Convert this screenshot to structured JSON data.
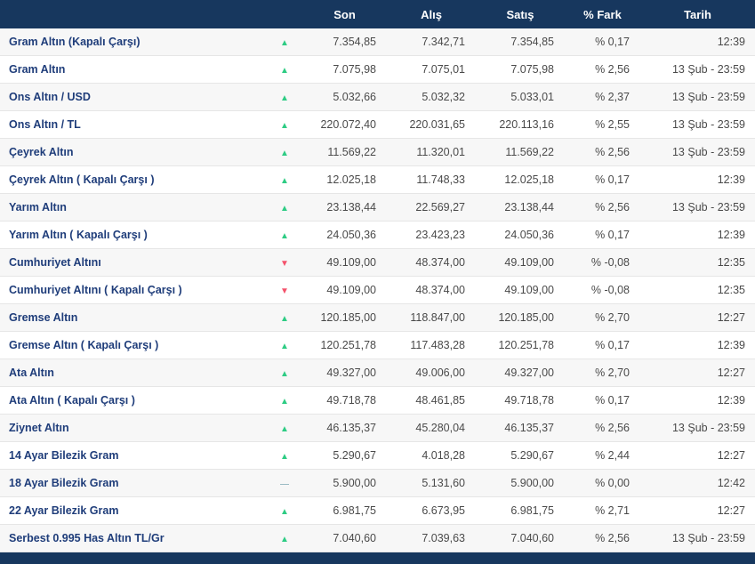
{
  "header": {
    "son": "Son",
    "alis": "Alış",
    "satis": "Satış",
    "fark": "% Fark",
    "tarih": "Tarih"
  },
  "icons": {
    "up": "▲",
    "down": "▼",
    "flat": "—"
  },
  "colors": {
    "header-bg": "#17375e",
    "name-color": "#1f3d7a",
    "value-color": "#4a4a4a",
    "up": "#2ecc84",
    "down": "#f4526b",
    "flat": "#9bbcc4",
    "row-alt": "#f7f7f7",
    "border": "#e6e6e6"
  },
  "rows": [
    {
      "name": "Gram Altın (Kapalı Çarşı)",
      "dir": "up",
      "son": "7.354,85",
      "alis": "7.342,71",
      "satis": "7.354,85",
      "fark": "% 0,17",
      "tarih": "12:39"
    },
    {
      "name": "Gram Altın",
      "dir": "up",
      "son": "7.075,98",
      "alis": "7.075,01",
      "satis": "7.075,98",
      "fark": "% 2,56",
      "tarih": "13 Şub - 23:59"
    },
    {
      "name": "Ons Altın / USD",
      "dir": "up",
      "son": "5.032,66",
      "alis": "5.032,32",
      "satis": "5.033,01",
      "fark": "% 2,37",
      "tarih": "13 Şub - 23:59"
    },
    {
      "name": "Ons Altın / TL",
      "dir": "up",
      "son": "220.072,40",
      "alis": "220.031,65",
      "satis": "220.113,16",
      "fark": "% 2,55",
      "tarih": "13 Şub - 23:59"
    },
    {
      "name": "Çeyrek Altın",
      "dir": "up",
      "son": "11.569,22",
      "alis": "11.320,01",
      "satis": "11.569,22",
      "fark": "% 2,56",
      "tarih": "13 Şub - 23:59"
    },
    {
      "name": "Çeyrek Altın ( Kapalı Çarşı )",
      "dir": "up",
      "son": "12.025,18",
      "alis": "11.748,33",
      "satis": "12.025,18",
      "fark": "% 0,17",
      "tarih": "12:39"
    },
    {
      "name": "Yarım Altın",
      "dir": "up",
      "son": "23.138,44",
      "alis": "22.569,27",
      "satis": "23.138,44",
      "fark": "% 2,56",
      "tarih": "13 Şub - 23:59"
    },
    {
      "name": "Yarım Altın ( Kapalı Çarşı )",
      "dir": "up",
      "son": "24.050,36",
      "alis": "23.423,23",
      "satis": "24.050,36",
      "fark": "% 0,17",
      "tarih": "12:39"
    },
    {
      "name": "Cumhuriyet Altını",
      "dir": "down",
      "son": "49.109,00",
      "alis": "48.374,00",
      "satis": "49.109,00",
      "fark": "% -0,08",
      "tarih": "12:35"
    },
    {
      "name": "Cumhuriyet Altını ( Kapalı Çarşı )",
      "dir": "down",
      "son": "49.109,00",
      "alis": "48.374,00",
      "satis": "49.109,00",
      "fark": "% -0,08",
      "tarih": "12:35"
    },
    {
      "name": "Gremse Altın",
      "dir": "up",
      "son": "120.185,00",
      "alis": "118.847,00",
      "satis": "120.185,00",
      "fark": "% 2,70",
      "tarih": "12:27"
    },
    {
      "name": "Gremse Altın ( Kapalı Çarşı )",
      "dir": "up",
      "son": "120.251,78",
      "alis": "117.483,28",
      "satis": "120.251,78",
      "fark": "% 0,17",
      "tarih": "12:39"
    },
    {
      "name": "Ata Altın",
      "dir": "up",
      "son": "49.327,00",
      "alis": "49.006,00",
      "satis": "49.327,00",
      "fark": "% 2,70",
      "tarih": "12:27"
    },
    {
      "name": "Ata Altın ( Kapalı Çarşı )",
      "dir": "up",
      "son": "49.718,78",
      "alis": "48.461,85",
      "satis": "49.718,78",
      "fark": "% 0,17",
      "tarih": "12:39"
    },
    {
      "name": "Ziynet Altın",
      "dir": "up",
      "son": "46.135,37",
      "alis": "45.280,04",
      "satis": "46.135,37",
      "fark": "% 2,56",
      "tarih": "13 Şub - 23:59"
    },
    {
      "name": "14 Ayar Bilezik Gram",
      "dir": "up",
      "son": "5.290,67",
      "alis": "4.018,28",
      "satis": "5.290,67",
      "fark": "% 2,44",
      "tarih": "12:27"
    },
    {
      "name": "18 Ayar Bilezik Gram",
      "dir": "flat",
      "son": "5.900,00",
      "alis": "5.131,60",
      "satis": "5.900,00",
      "fark": "% 0,00",
      "tarih": "12:42"
    },
    {
      "name": "22 Ayar Bilezik Gram",
      "dir": "up",
      "son": "6.981,75",
      "alis": "6.673,95",
      "satis": "6.981,75",
      "fark": "% 2,71",
      "tarih": "12:27"
    },
    {
      "name": "Serbest 0.995 Has Altın TL/Gr",
      "dir": "up",
      "son": "7.040,60",
      "alis": "7.039,63",
      "satis": "7.040,60",
      "fark": "% 2,56",
      "tarih": "13 Şub - 23:59"
    }
  ]
}
